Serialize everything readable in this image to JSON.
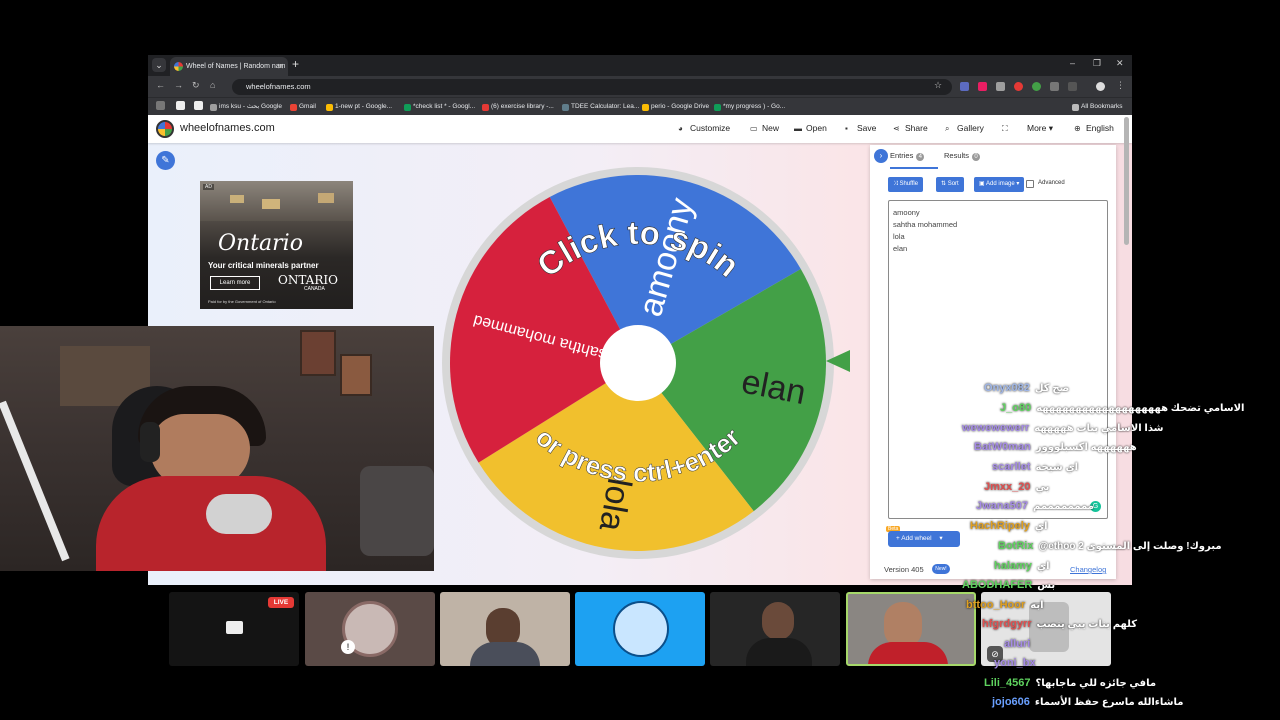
{
  "browser": {
    "tab_title": "Wheel of Names | Random nam",
    "url": "wheelofnames.com",
    "bookmarks": [
      {
        "label": "ims ksu - بحث Google",
        "color": "#9e9e9e"
      },
      {
        "label": "Gmail",
        "color": "#ea4335"
      },
      {
        "label": "1-new pt - Google...",
        "color": "#fbbc04"
      },
      {
        "label": "*check list * - Googl...",
        "color": "#0f9d58"
      },
      {
        "label": "(6) exercise library -...",
        "color": "#e53935"
      },
      {
        "label": "TDEE Calculator: Lea...",
        "color": "#607d8b"
      },
      {
        "label": "perio - Google Drive",
        "color": "#fbbc04"
      },
      {
        "label": "*my progress ) - Go...",
        "color": "#0f9d58"
      }
    ],
    "all_bookmarks": "All Bookmarks"
  },
  "site": {
    "name": "wheelofnames.com",
    "menu": {
      "customize": "Customize",
      "new": "New",
      "open": "Open",
      "save": "Save",
      "share": "Share",
      "gallery": "Gallery",
      "more": "More",
      "language": "English"
    }
  },
  "ad": {
    "tag": "AD",
    "headline": "Ontario",
    "subline": "Your critical minerals partner",
    "button": "Learn more",
    "brand": "ONTARIO",
    "brand_sub": "CANADA",
    "fine_print": "Paid for by the Government of Ontario"
  },
  "wheel": {
    "prompt_top": "Click to spin",
    "prompt_bottom": "or press ctrl+enter",
    "segments": [
      {
        "label": "amoony",
        "color": "#3f75d8"
      },
      {
        "label": "elan",
        "color": "#43a047"
      },
      {
        "label": "lola",
        "color": "#f1c02d"
      },
      {
        "label": "sahtha mohammed",
        "color": "#d6213d"
      }
    ]
  },
  "panel": {
    "tab_entries": "Entries",
    "entries_count": "4",
    "tab_results": "Results",
    "results_count": "0",
    "shuffle": "Shuffle",
    "sort": "Sort",
    "add_image": "Add image",
    "advanced": "Advanced",
    "entries": [
      "amoony",
      "sahtha mohammed",
      "lola",
      "elan"
    ],
    "beta": "Beta",
    "add_wheel": "Add wheel",
    "version": "Version 405",
    "new_badge": "New!",
    "changelog": "Changelog"
  },
  "stream": {
    "live": "LIVE"
  },
  "chat": [
    {
      "name": "Onyx082",
      "color": "#9fb6e6",
      "msg": "صح كل"
    },
    {
      "name": "J_o80",
      "color": "#5fd35f",
      "msg": "الاسامي تضحك هههههههههههههههههههه"
    },
    {
      "name": "wewewewerr",
      "color": "#a58be6",
      "msg": "شذا الاسامي بنات هههههه"
    },
    {
      "name": "BatW0man",
      "color": "#a58be6",
      "msg": "ههههههه اكسبلووور"
    },
    {
      "name": "scarllet",
      "color": "#a58be6",
      "msg": "اي شيخة"
    },
    {
      "name": "Jmxx_20",
      "color": "#e05050",
      "msg": "بي"
    },
    {
      "name": "Jwana507",
      "color": "#a58be6",
      "msg": "ممممممممم"
    },
    {
      "name": "HachRipely",
      "color": "#e0a020",
      "msg": "اي"
    },
    {
      "name": "BotRix",
      "color": "#5fd35f",
      "msg": "@ethoo مبروك! وصلت إلى المستوى 2"
    },
    {
      "name": "halamy",
      "color": "#5fd35f",
      "msg": "اي"
    },
    {
      "name": "ABODHAFER",
      "color": "#5fd35f",
      "msg": "بس"
    },
    {
      "name": "bttoo_Hoor",
      "color": "#e0a020",
      "msg": "ابه"
    },
    {
      "name": "hfgrdgyrr",
      "color": "#e05050",
      "msg": "كلهم بنات يبي ينصب"
    },
    {
      "name": "alluri",
      "color": "#a58be6",
      "msg": ""
    },
    {
      "name": "yoni_bx",
      "color": "#a58be6",
      "msg": ""
    },
    {
      "name": "Lili_4567",
      "color": "#5fd35f",
      "msg": "مافي جائزه للي ماجابها؟"
    },
    {
      "name": "jojo606",
      "color": "#6aa0ff",
      "msg": "ماشاءالله ماسرع حفظ الأسماء"
    }
  ]
}
